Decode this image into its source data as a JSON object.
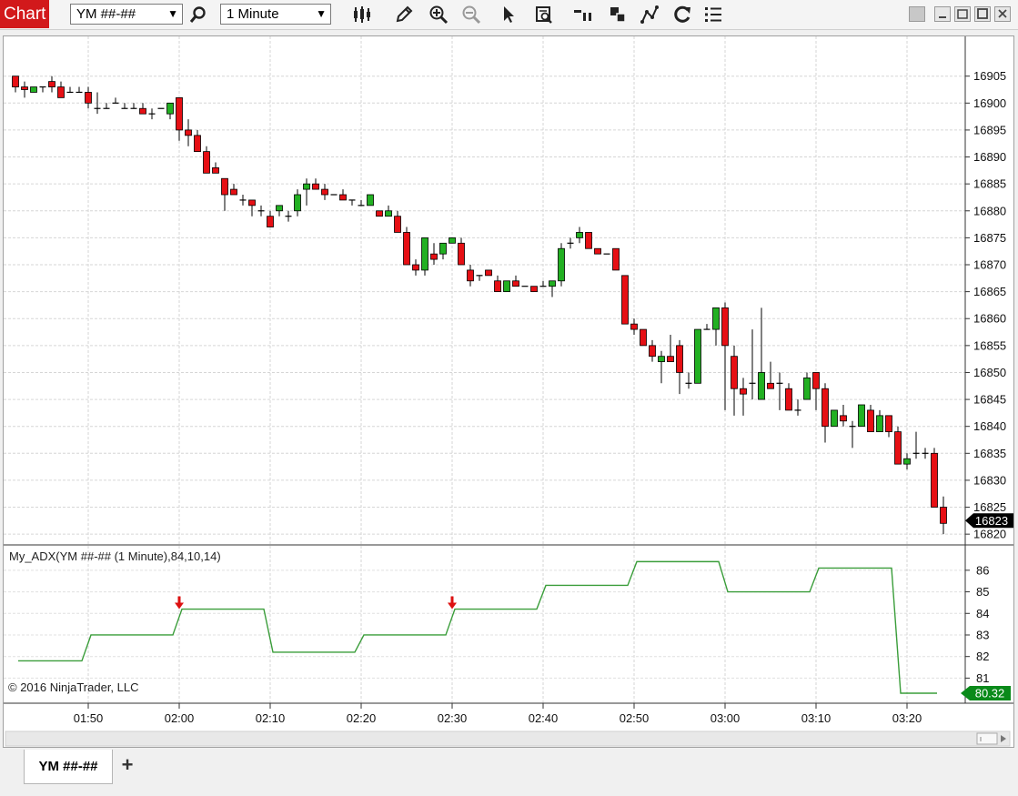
{
  "window": {
    "title": "Chart",
    "instrument": "YM ##-##",
    "interval": "1 Minute"
  },
  "toolbar_icons": [
    "search-icon",
    "bars-icon",
    "pencil-icon",
    "zoom-in-icon",
    "zoom-out-icon",
    "pointer-icon",
    "data-box-icon",
    "plot-style-icon",
    "layers-icon",
    "strategy-icon",
    "refresh-icon",
    "list-icon"
  ],
  "price_panel": {
    "price_ticks": [
      "16905",
      "16900",
      "16895",
      "16890",
      "16885",
      "16880",
      "16875",
      "16870",
      "16865",
      "16860",
      "16855",
      "16850",
      "16845",
      "16840",
      "16835",
      "16830",
      "16825",
      "16820"
    ],
    "last_price": "16823",
    "ylim": [
      16818,
      16909
    ]
  },
  "indicator_panel": {
    "label": "My_ADX(YM ##-## (1 Minute),84,10,14)",
    "ticks": [
      "86",
      "85",
      "84",
      "83",
      "82",
      "81"
    ],
    "last_value": "80.32",
    "copyright": "© 2016 NinjaTrader, LLC"
  },
  "time_ticks": [
    "01:50",
    "02:00",
    "02:10",
    "02:20",
    "02:30",
    "02:40",
    "02:50",
    "03:00",
    "03:10",
    "03:20"
  ],
  "tab": {
    "label": "YM ##-##",
    "add_label": "+"
  },
  "colors": {
    "up": "#22b022",
    "down": "#e60f14",
    "adx": "#3a9d3a",
    "accent": "#d2191b",
    "last_value_bg": "#0a8a1a"
  },
  "chart_data": {
    "type": "candlestick",
    "bar_interval": "1 Minute",
    "start_time": "01:42",
    "x_ticks": [
      "01:50",
      "02:00",
      "02:10",
      "02:20",
      "02:30",
      "02:40",
      "02:50",
      "03:00",
      "03:10",
      "03:20"
    ],
    "ylim": [
      16818,
      16909
    ],
    "candles": [
      [
        16905,
        16905,
        16902,
        16903
      ],
      [
        16903,
        16904,
        16901,
        16902.5
      ],
      [
        16902,
        16903,
        16902,
        16903
      ],
      [
        16903,
        16903,
        16902,
        16903
      ],
      [
        16904,
        16905,
        16902,
        16903
      ],
      [
        16903,
        16904,
        16901,
        16901
      ],
      [
        16902,
        16903,
        16902,
        16902
      ],
      [
        16902,
        16903,
        16902,
        16902
      ],
      [
        16902,
        16903,
        16899,
        16900
      ],
      [
        16899,
        16902,
        16898,
        16899
      ],
      [
        16899,
        16900,
        16899,
        16899
      ],
      [
        16900,
        16901,
        16900,
        16900
      ],
      [
        16899,
        16900,
        16899,
        16899
      ],
      [
        16899,
        16900,
        16899,
        16899
      ],
      [
        16899,
        16900,
        16898,
        16898
      ],
      [
        16898,
        16899,
        16897,
        16898
      ],
      [
        16899,
        16899,
        16899,
        16899
      ],
      [
        16898,
        16900,
        16897,
        16900
      ],
      [
        16901,
        16901,
        16893,
        16895
      ],
      [
        16895,
        16897,
        16892,
        16894
      ],
      [
        16894,
        16895,
        16891,
        16891
      ],
      [
        16891,
        16892,
        16887,
        16887
      ],
      [
        16888,
        16889,
        16887,
        16887
      ],
      [
        16886,
        16886,
        16880,
        16883
      ],
      [
        16884,
        16885,
        16883,
        16883
      ],
      [
        16882,
        16883,
        16881,
        16882
      ],
      [
        16882,
        16882,
        16879,
        16881
      ],
      [
        16880,
        16881,
        16879,
        16880
      ],
      [
        16879,
        16880,
        16877,
        16877
      ],
      [
        16880,
        16881,
        16879,
        16881
      ],
      [
        16879,
        16880,
        16878,
        16879
      ],
      [
        16880,
        16884,
        16879,
        16883
      ],
      [
        16884,
        16886,
        16881,
        16885
      ],
      [
        16885,
        16886,
        16884,
        16884
      ],
      [
        16884,
        16885,
        16882,
        16883
      ],
      [
        16883,
        16883,
        16883,
        16883
      ],
      [
        16883,
        16884,
        16882,
        16882
      ],
      [
        16882,
        16882,
        16881,
        16882
      ],
      [
        16881,
        16882,
        16881,
        16881
      ],
      [
        16881,
        16883,
        16881,
        16883
      ],
      [
        16880,
        16880,
        16879,
        16879
      ],
      [
        16879,
        16881,
        16879,
        16880
      ],
      [
        16879,
        16880,
        16876,
        16876
      ],
      [
        16876,
        16877,
        16870,
        16870
      ],
      [
        16870,
        16871,
        16868,
        16869
      ],
      [
        16869,
        16875,
        16868,
        16875
      ],
      [
        16872,
        16874,
        16870,
        16871
      ],
      [
        16872,
        16874,
        16871,
        16874
      ],
      [
        16874,
        16875,
        16874,
        16875
      ],
      [
        16874,
        16875,
        16870,
        16870
      ],
      [
        16869,
        16870,
        16866,
        16867
      ],
      [
        16868,
        16868,
        16867,
        16868
      ],
      [
        16869,
        16869,
        16868,
        16868
      ],
      [
        16867,
        16868,
        16865,
        16865
      ],
      [
        16865,
        16867,
        16865,
        16867
      ],
      [
        16867,
        16868,
        16866,
        16866
      ],
      [
        16866,
        16866,
        16866,
        16866
      ],
      [
        16866,
        16866,
        16865,
        16865
      ],
      [
        16866,
        16867,
        16866,
        16866
      ],
      [
        16866,
        16867,
        16864,
        16867
      ],
      [
        16867,
        16874,
        16866,
        16873
      ],
      [
        16874,
        16875,
        16873,
        16874
      ],
      [
        16875,
        16877,
        16874,
        16876
      ],
      [
        16876,
        16876,
        16873,
        16873
      ],
      [
        16873,
        16873,
        16872,
        16872
      ],
      [
        16872,
        16872,
        16872,
        16872
      ],
      [
        16873,
        16873,
        16869,
        16869
      ],
      [
        16868,
        16868,
        16859,
        16859
      ],
      [
        16859,
        16860,
        16857,
        16858
      ],
      [
        16858,
        16858,
        16855,
        16855
      ],
      [
        16855,
        16856,
        16852,
        16853
      ],
      [
        16852,
        16854,
        16848,
        16853
      ],
      [
        16853,
        16857,
        16852,
        16852
      ],
      [
        16855,
        16856,
        16846,
        16850
      ],
      [
        16848,
        16850,
        16847,
        16848
      ],
      [
        16848,
        16858,
        16848,
        16858
      ],
      [
        16858,
        16859,
        16858,
        16858
      ],
      [
        16858,
        16862,
        16855,
        16862
      ],
      [
        16862,
        16863,
        16843,
        16855
      ],
      [
        16853,
        16855,
        16842,
        16847
      ],
      [
        16847,
        16849,
        16842,
        16846
      ],
      [
        16848,
        16858,
        16845,
        16848
      ],
      [
        16845,
        16862,
        16845,
        16850
      ],
      [
        16848,
        16852,
        16847,
        16847
      ],
      [
        16848,
        16850,
        16843,
        16848
      ],
      [
        16847,
        16848,
        16843,
        16843
      ],
      [
        16843,
        16845,
        16842,
        16843
      ],
      [
        16845,
        16850,
        16845,
        16849
      ],
      [
        16850,
        16850,
        16843,
        16847
      ],
      [
        16847,
        16848,
        16837,
        16840
      ],
      [
        16840,
        16843,
        16840,
        16843
      ],
      [
        16842,
        16844,
        16840,
        16841
      ],
      [
        16840,
        16841,
        16836,
        16840
      ],
      [
        16840,
        16844,
        16840,
        16844
      ],
      [
        16843,
        16844,
        16839,
        16839
      ],
      [
        16839,
        16843,
        16839,
        16842
      ],
      [
        16842,
        16842,
        16838,
        16839
      ],
      [
        16839,
        16840,
        16833,
        16833
      ],
      [
        16833,
        16835,
        16832,
        16834
      ],
      [
        16835,
        16839,
        16834,
        16835
      ],
      [
        16835,
        16836,
        16834,
        16835
      ],
      [
        16835,
        16836,
        16825,
        16825
      ],
      [
        16825,
        16827,
        16820,
        16822
      ]
    ],
    "adx_series": {
      "ylim": [
        80.3,
        86.5
      ],
      "points": [
        [
          0,
          81.8
        ],
        [
          7,
          81.8
        ],
        [
          8,
          83.0
        ],
        [
          17,
          83.0
        ],
        [
          18,
          84.2
        ],
        [
          27,
          84.2
        ],
        [
          28,
          82.2
        ],
        [
          37,
          82.2
        ],
        [
          38,
          83.0
        ],
        [
          47,
          83.0
        ],
        [
          48,
          84.2
        ],
        [
          57,
          84.2
        ],
        [
          58,
          85.3
        ],
        [
          67,
          85.3
        ],
        [
          68,
          86.4
        ],
        [
          77,
          86.4
        ],
        [
          78,
          85.0
        ],
        [
          87,
          85.0
        ],
        [
          88,
          86.1
        ],
        [
          96,
          86.1
        ],
        [
          97,
          80.3
        ],
        [
          101,
          80.3
        ]
      ]
    },
    "signals": [
      {
        "bar": 18,
        "dir": "down"
      },
      {
        "bar": 48,
        "dir": "down"
      }
    ]
  }
}
